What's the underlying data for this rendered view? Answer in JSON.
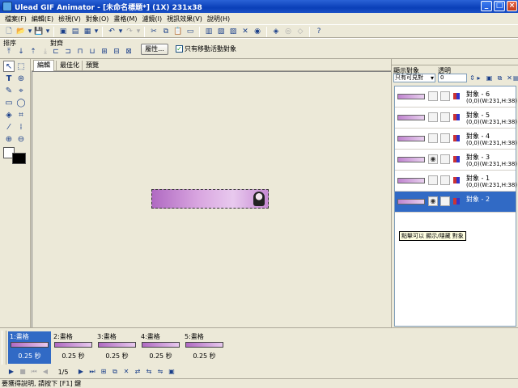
{
  "window": {
    "title": "Ulead GIF Animator - [未命名標題*] (1X) 231x38",
    "minimize": "_",
    "maximize": "□",
    "close": "×"
  },
  "menu": [
    "檔案(F)",
    "編輯(E)",
    "檢視(V)",
    "對象(O)",
    "畫格(M)",
    "濾鏡(I)",
    "視訊效果(V)",
    "說明(H)"
  ],
  "toolbar2": {
    "arrange_label": "排序",
    "align_label": "對齊",
    "properties_button": "屬性...",
    "move_only_checkbox_label": "只有移動活動對象",
    "move_only_checked": true
  },
  "tabs": [
    "編輯",
    "最佳化",
    "預覽"
  ],
  "right_panel": {
    "show_objects_label": "顯示對象",
    "transparency_label": "透明",
    "show_select_value": "只有可見對",
    "transparency_value": "0",
    "objects": [
      {
        "name": "對象 - 6",
        "info": "(0,0)(W:231,H:38)",
        "visible": false,
        "selected": false
      },
      {
        "name": "對象 - 5",
        "info": "(0,0)(W:231,H:38)",
        "visible": false,
        "selected": false
      },
      {
        "name": "對象 - 4",
        "info": "(0,0)(W:231,H:38)",
        "visible": false,
        "selected": false
      },
      {
        "name": "對象 - 3",
        "info": "(0,0)(W:231,H:38)",
        "visible": true,
        "selected": false
      },
      {
        "name": "對象 - 1",
        "info": "(0,0)(W:231,H:38)",
        "visible": false,
        "selected": false
      },
      {
        "name": "對象 - 2",
        "info": "",
        "visible": true,
        "selected": true
      }
    ],
    "tooltip": "點擊可以 顯示/隱藏 對象"
  },
  "frames": [
    {
      "label": "1:畫格",
      "delay": "0.25 秒",
      "selected": true
    },
    {
      "label": "2:畫格",
      "delay": "0.25 秒",
      "selected": false
    },
    {
      "label": "3:畫格",
      "delay": "0.25 秒",
      "selected": false
    },
    {
      "label": "4:畫格",
      "delay": "0.25 秒",
      "selected": false
    },
    {
      "label": "5:畫格",
      "delay": "0.25 秒",
      "selected": false
    }
  ],
  "frame_counter": "1/5",
  "status": "要獲得說明, 請按下 [F1] 鍵",
  "colors": {
    "titlebar": "#0a3fb8",
    "selection": "#316ac5",
    "foreground_color": "#ffffff",
    "background_color": "#000000"
  }
}
